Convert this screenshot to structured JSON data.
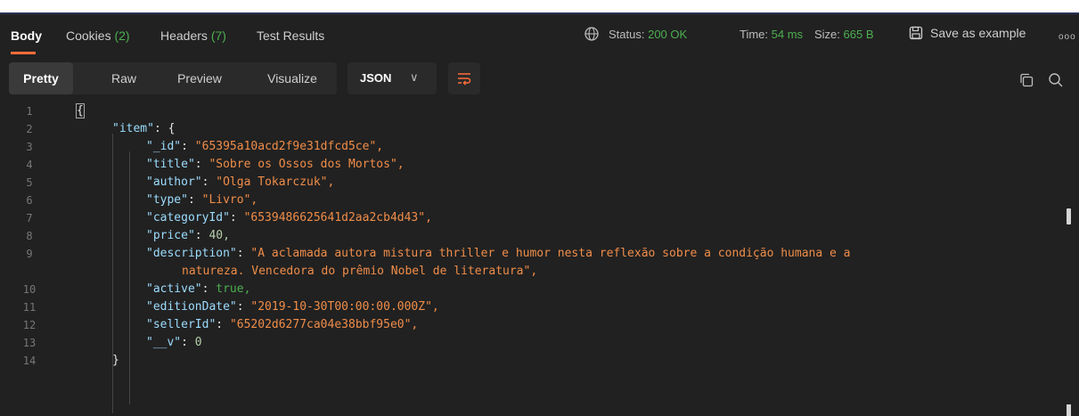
{
  "tabs": {
    "body": "Body",
    "cookies": "Cookies",
    "cookies_count": "(2)",
    "headers": "Headers",
    "headers_count": "(7)",
    "test_results": "Test Results"
  },
  "status": {
    "status_label": "Status:",
    "status_value": "200 OK",
    "time_label": "Time:",
    "time_value": "54 ms",
    "size_label": "Size:",
    "size_value": "665 B"
  },
  "actions": {
    "save_as_example": "Save as example",
    "more": "ooo"
  },
  "view_modes": {
    "pretty": "Pretty",
    "raw": "Raw",
    "preview": "Preview",
    "visualize": "Visualize"
  },
  "format": {
    "selected": "JSON",
    "chevron": "∨"
  },
  "code": {
    "line_numbers": [
      "1",
      "2",
      "3",
      "4",
      "5",
      "6",
      "7",
      "8",
      "9",
      "",
      "10",
      "11",
      "12",
      "13",
      "14"
    ],
    "lines": [
      {
        "key": "",
        "value": "{"
      },
      {
        "key": "\"item\"",
        "value": "{"
      },
      {
        "key": "\"_id\"",
        "value": "\"65395a10acd2f9e31dfcd5ce\","
      },
      {
        "key": "\"title\"",
        "value": "\"Sobre os Ossos dos Mortos\","
      },
      {
        "key": "\"author\"",
        "value": "\"Olga Tokarczuk\","
      },
      {
        "key": "\"type\"",
        "value": "\"Livro\","
      },
      {
        "key": "\"categoryId\"",
        "value": "\"6539486625641d2aa2cb4d43\","
      },
      {
        "key": "\"price\"",
        "value": "40,"
      },
      {
        "key": "\"description\"",
        "value": "\"A aclamada autora mistura thriller e humor nesta reflexão sobre a condição humana e a"
      },
      {
        "key": "",
        "value": "natureza. Vencedora do prêmio Nobel de literatura\","
      },
      {
        "key": "\"active\"",
        "value": "true,"
      },
      {
        "key": "\"editionDate\"",
        "value": "\"2019-10-30T00:00:00.000Z\","
      },
      {
        "key": "\"sellerId\"",
        "value": "\"65202d6277ca04e38bbf95e0\","
      },
      {
        "key": "\"__v\"",
        "value": "0"
      },
      {
        "key": "",
        "value": "}"
      }
    ]
  },
  "colors": {
    "accent": "#ff6c37",
    "status_green": "#4caf50",
    "key": "#9cdcfe",
    "string": "#f08d49"
  }
}
